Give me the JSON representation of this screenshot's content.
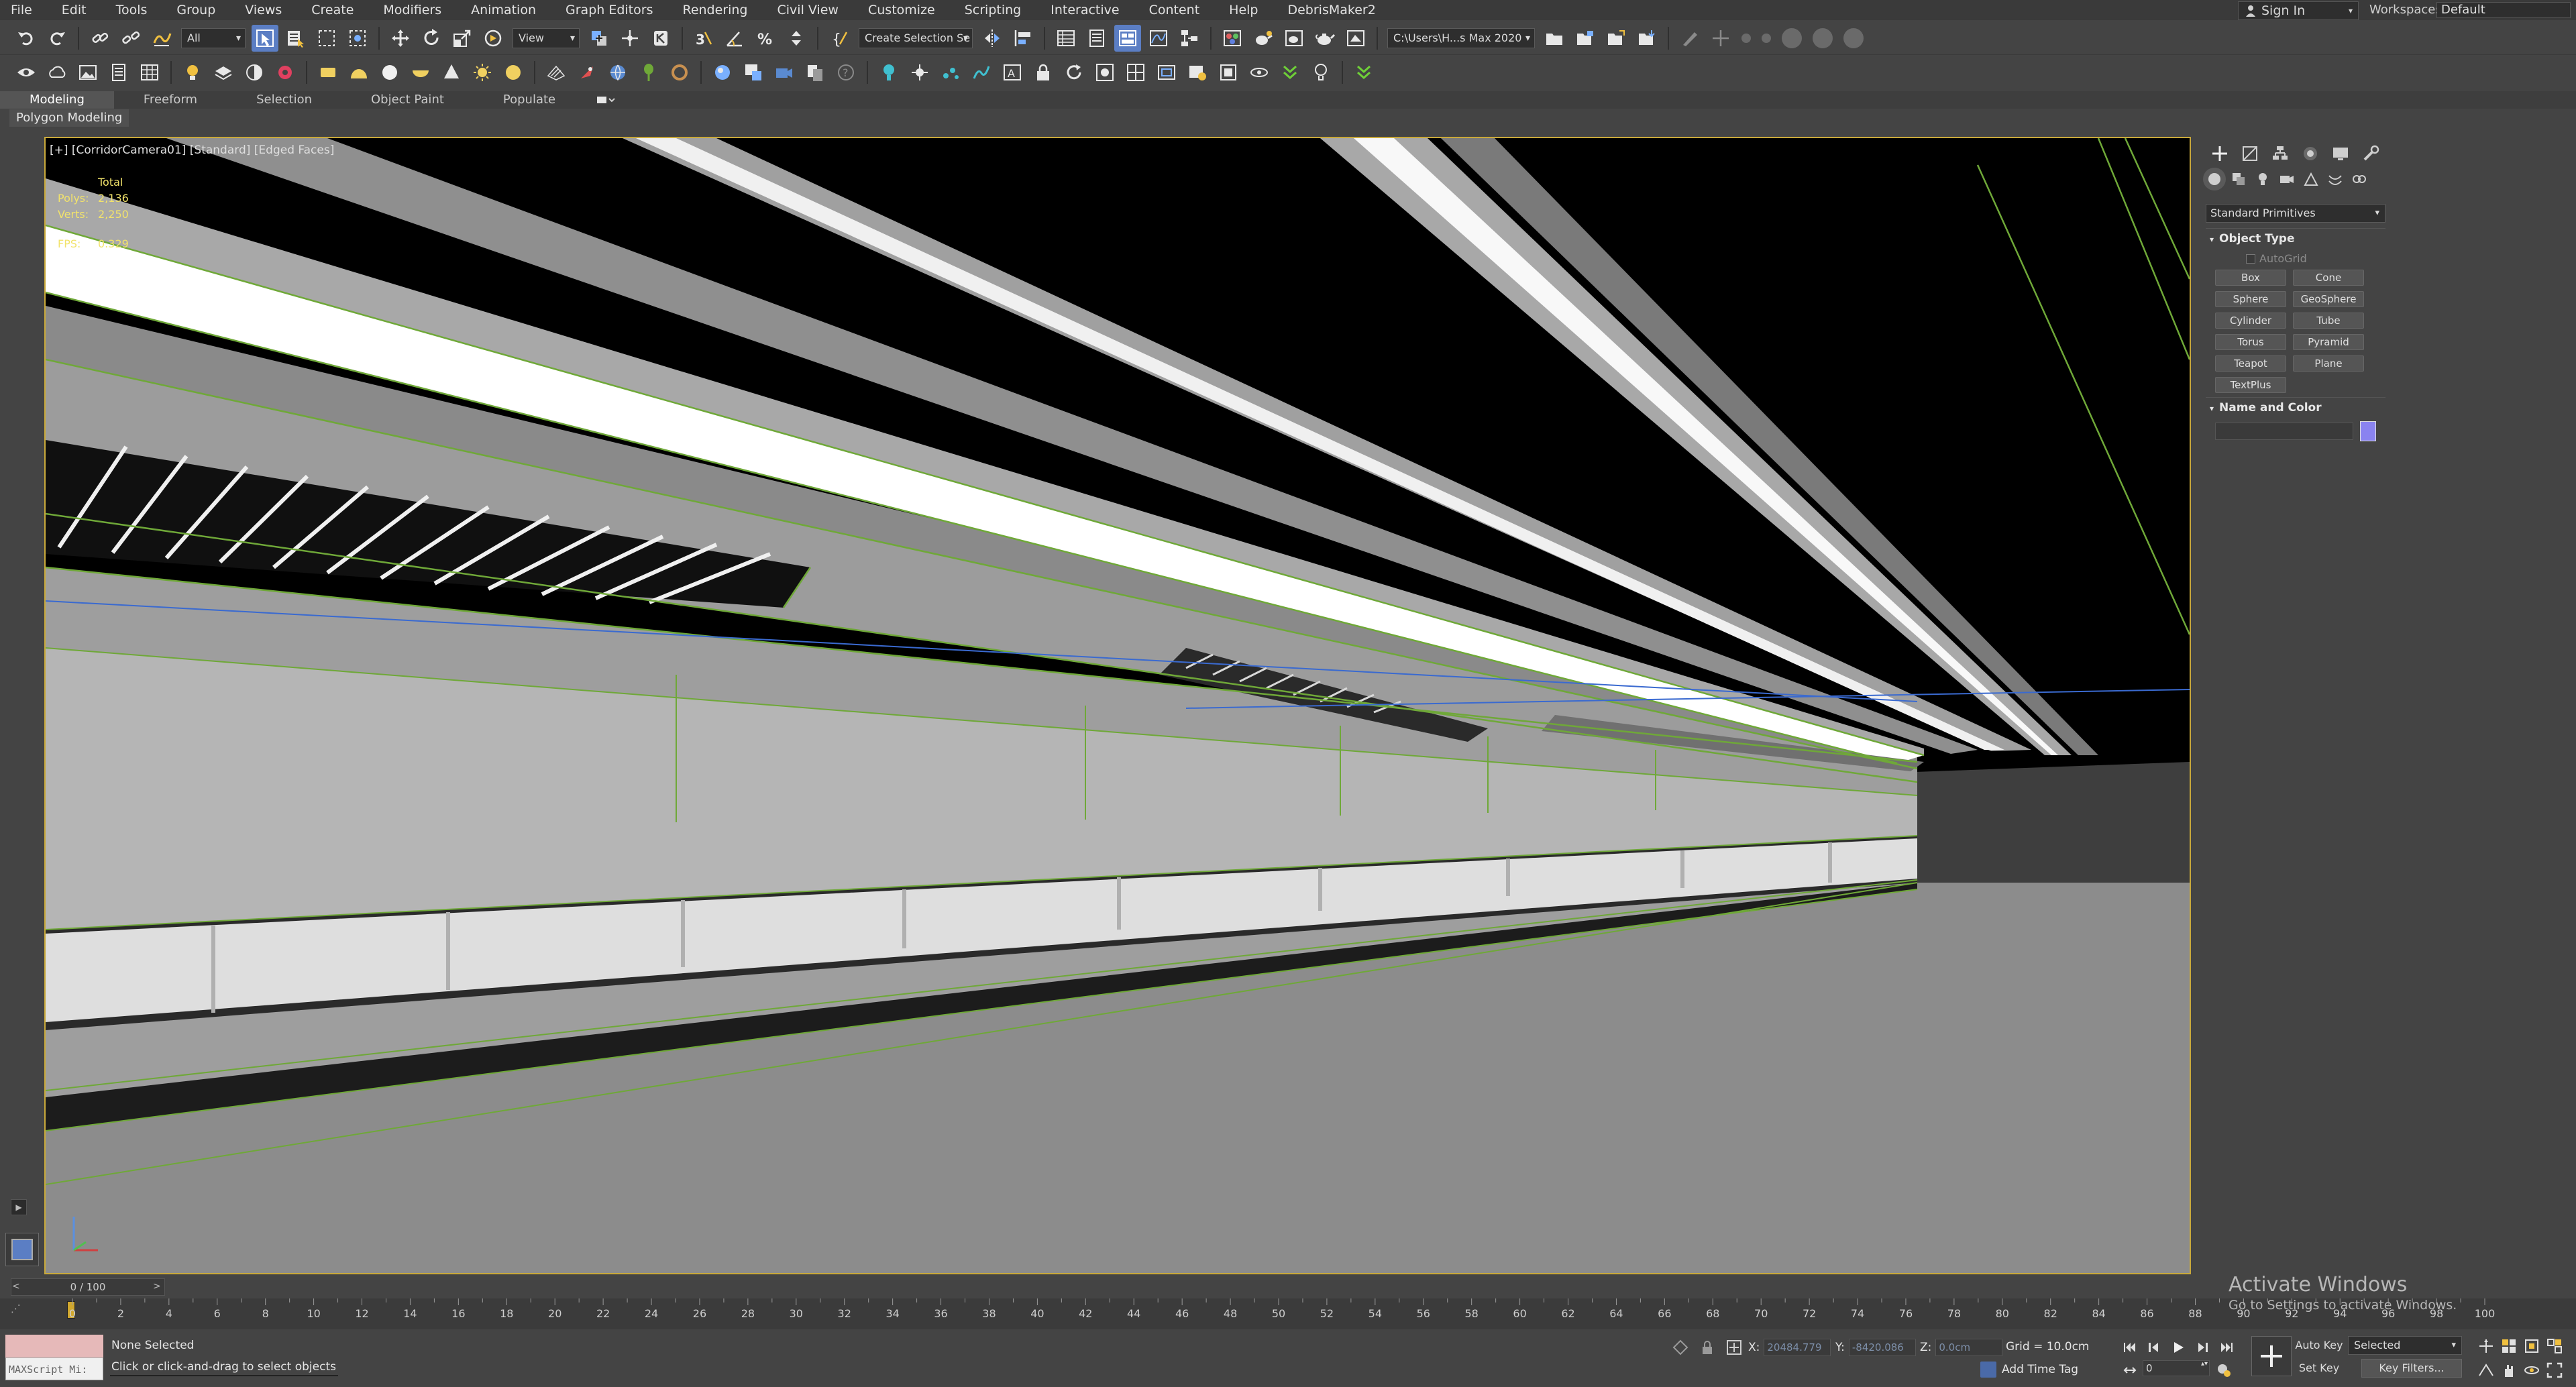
{
  "menu": [
    "File",
    "Edit",
    "Tools",
    "Group",
    "Views",
    "Create",
    "Modifiers",
    "Animation",
    "Graph Editors",
    "Rendering",
    "Civil View",
    "Customize",
    "Scripting",
    "Interactive",
    "Content",
    "Help",
    "DebrisMaker2"
  ],
  "account": {
    "sign_in": "Sign In",
    "workspaces_label": "Workspaces:",
    "workspace": "Default"
  },
  "toolbar": {
    "selection_filter": "All",
    "ref_coord": "View",
    "selection_set": "Create Selection Se",
    "project_path": "C:\\Users\\H...s Max 2020"
  },
  "ribbon": {
    "tabs": [
      "Modeling",
      "Freeform",
      "Selection",
      "Object Paint",
      "Populate"
    ],
    "active_tab": "Modeling",
    "sub_panel": "Polygon Modeling"
  },
  "viewport": {
    "label": "[+] [CorridorCamera01] [Standard] [Edged Faces]",
    "stats": {
      "total_label": "Total",
      "polys_label": "Polys:",
      "polys": "2,136",
      "verts_label": "Verts:",
      "verts": "2,250",
      "fps_label": "FPS:",
      "fps": "0.329"
    }
  },
  "command_panel": {
    "dropdown": "Standard Primitives",
    "object_type_title": "Object Type",
    "autogrid": "AutoGrid",
    "primitives": [
      "Box",
      "Cone",
      "Sphere",
      "GeoSphere",
      "Cylinder",
      "Tube",
      "Torus",
      "Pyramid",
      "Teapot",
      "Plane",
      "TextPlus"
    ],
    "name_color_title": "Name and Color",
    "object_color": "#8a83f0"
  },
  "timeline": {
    "slider": "0 / 100",
    "ticks": [
      "0",
      "2",
      "4",
      "6",
      "8",
      "10",
      "12",
      "14",
      "16",
      "18",
      "20",
      "22",
      "24",
      "26",
      "28",
      "30",
      "32",
      "34",
      "36",
      "38",
      "40",
      "42",
      "44",
      "46",
      "48",
      "50",
      "52",
      "54",
      "56",
      "58",
      "60",
      "62",
      "64",
      "66",
      "68",
      "70",
      "72",
      "74",
      "76",
      "78",
      "80",
      "82",
      "84",
      "86",
      "88",
      "90",
      "92",
      "94",
      "96",
      "98",
      "100"
    ]
  },
  "status": {
    "maxscript": "MAXScript Mi:",
    "selection": "None Selected",
    "prompt": "Click or click-and-drag to select objects",
    "x_label": "X:",
    "x_value": "20484.779",
    "y_label": "Y:",
    "y_value": "-8420.086",
    "z_label": "Z:",
    "z_value": "0.0cm",
    "grid": "Grid = 10.0cm",
    "add_time_tag": "Add Time Tag",
    "frame": "0",
    "auto_key": "Auto Key",
    "set_key": "Set Key",
    "key_mode": "Selected",
    "key_filters": "Key Filters..."
  },
  "watermark": {
    "title": "Activate Windows",
    "subtitle": "Go to Settings to activate Windows."
  },
  "colors": {
    "accent": "#5b7ec4",
    "viewport_border": "#c9a93b",
    "edge": "#6fa838",
    "stats": "#f2e36b"
  }
}
